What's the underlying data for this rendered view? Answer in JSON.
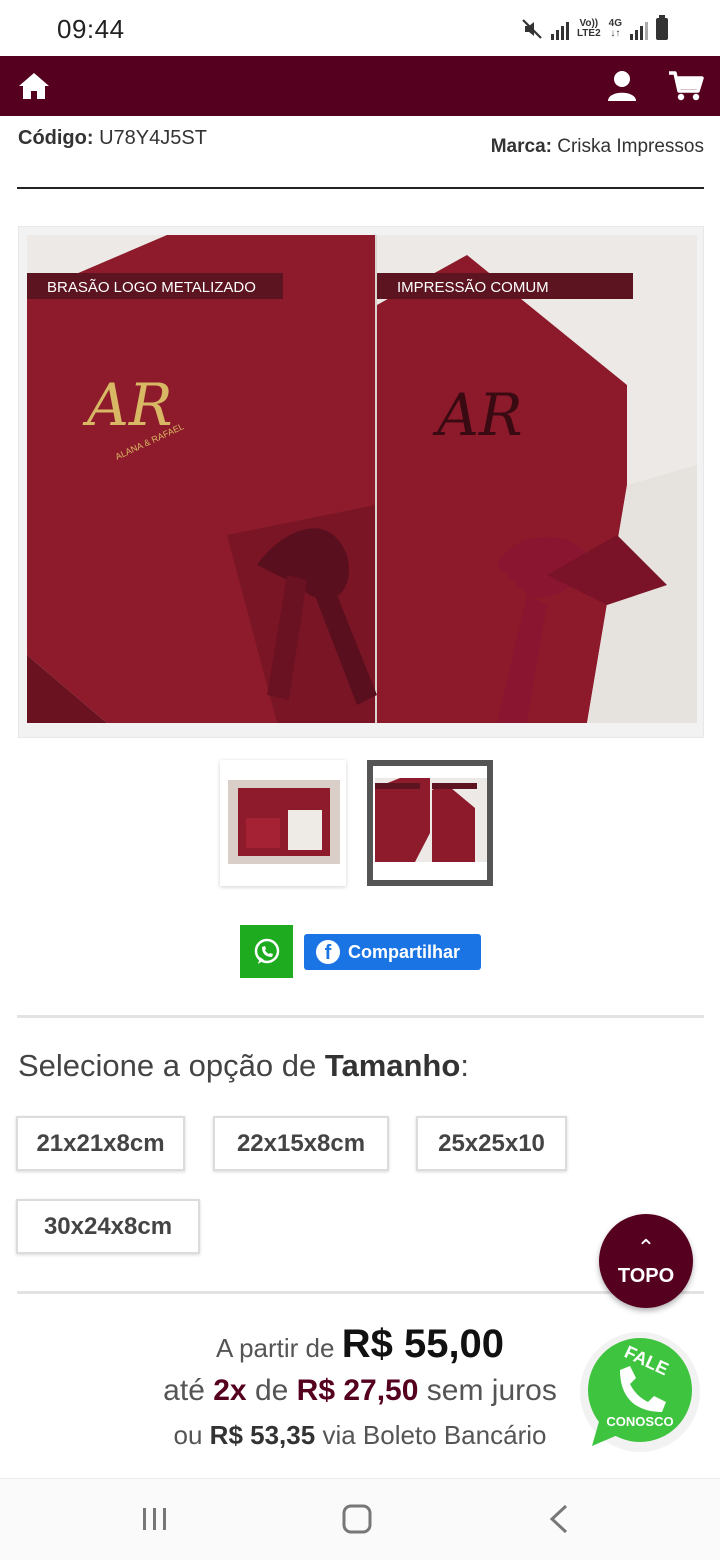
{
  "status_bar": {
    "time": "09:44",
    "net_top": "Vo))",
    "net_bottom": "LTE2",
    "gen_top": "4G",
    "gen_bottom": "↓↑"
  },
  "nav": {
    "home_icon": "home-icon",
    "user_icon": "user-icon",
    "cart_icon": "cart-icon",
    "color": "#560020"
  },
  "product": {
    "code_label": "Código:",
    "code_value": "U78Y4J5ST",
    "brand_label": "Marca:",
    "brand_value": "Criska Impressos",
    "image_label_left": "BRASÃO LOGO METALIZADO",
    "image_label_right": "IMPRESSÃO COMUM",
    "monogram": "AR",
    "names": "ALANA & RAFAEL"
  },
  "share": {
    "facebook_label": "Compartilhar"
  },
  "options": {
    "title_prefix": "Selecione a opção de",
    "title_bold": "Tamanho",
    "title_suffix": ":",
    "sizes": [
      "21x21x8cm",
      "22x15x8cm",
      "25x25x10",
      "30x24x8cm"
    ]
  },
  "price": {
    "from_label": "A partir de",
    "from_value": "R$ 55,00",
    "installment_prefix": "até",
    "installment_count": "2x",
    "installment_of": "de",
    "installment_value": "R$ 27,50",
    "installment_suffix": "sem juros",
    "boleto_prefix": "ou",
    "boleto_value": "R$ 53,35",
    "boleto_suffix": "via Boleto Bancário"
  },
  "floating": {
    "topo_label": "TOPO",
    "fale_top": "FALE",
    "fale_bottom": "CONOSCO"
  }
}
